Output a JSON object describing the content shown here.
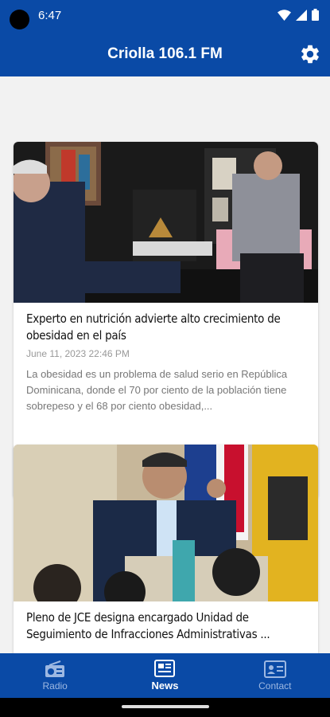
{
  "status": {
    "time": "6:47",
    "icons": [
      "wifi-icon",
      "signal-icon",
      "battery-icon"
    ]
  },
  "app": {
    "title": "Criolla 106.1 FM",
    "settings_icon": "gear-icon"
  },
  "articles": [
    {
      "title": "Experto en nutrición advierte alto crecimiento de obesidad en el país",
      "date": "June 11, 2023 22:46 PM",
      "excerpt": "La obesidad es un problema de salud serio en República Dominicana, donde el 70 por ciento de la población tiene sobrepeso y el 68 por ciento obesidad,..."
    },
    {
      "title": "Pleno de JCE designa encargado Unidad de Seguimiento de Infracciones Administrativas ..."
    }
  ],
  "nav": {
    "items": [
      {
        "label": "Radio",
        "icon": "radio-icon",
        "active": false
      },
      {
        "label": "News",
        "icon": "newspaper-icon",
        "active": true
      },
      {
        "label": "Contact",
        "icon": "contact-card-icon",
        "active": false
      }
    ]
  },
  "colors": {
    "primary": "#0a4aa6",
    "nav_inactive": "#9db8e2",
    "background": "#f2f2f2"
  }
}
